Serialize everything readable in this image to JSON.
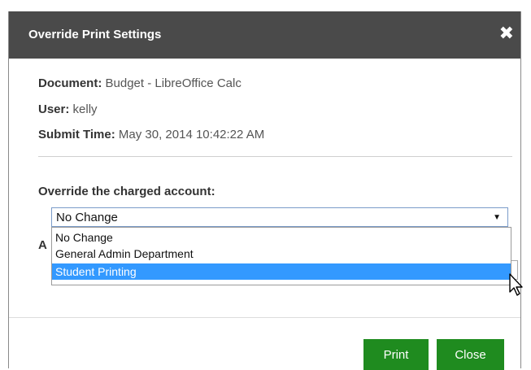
{
  "dialog": {
    "title": "Override Print Settings",
    "close_glyph": "✖"
  },
  "info": {
    "document_label": "Document:",
    "document_value": "Budget - LibreOffice Calc",
    "user_label": "User:",
    "user_value": "kelly",
    "submit_label": "Submit Time:",
    "submit_value": "May 30, 2014 10:42:22 AM"
  },
  "account": {
    "label": "Override the charged account:",
    "selected": "No Change",
    "options": [
      "No Change",
      "General Admin Department",
      "Student Printing"
    ],
    "highlighted_option": "Student Printing"
  },
  "obscured_label_initial": "A",
  "buttons": {
    "print": "Print",
    "close": "Close"
  },
  "colors": {
    "titlebar": "#4a4a4a",
    "highlight": "#3399ff",
    "button": "#1f8b1f"
  }
}
